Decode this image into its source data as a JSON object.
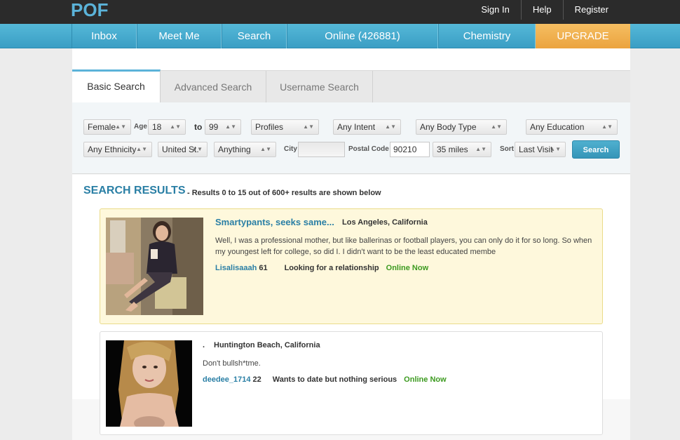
{
  "top": {
    "logo": "POF",
    "links": [
      "Sign In",
      "Help",
      "Register"
    ]
  },
  "nav": {
    "items": [
      "Inbox",
      "Meet Me",
      "Search",
      "Online (426881)",
      "Chemistry",
      "UPGRADE"
    ]
  },
  "tabs": [
    "Basic Search",
    "Advanced Search",
    "Username Search"
  ],
  "filters": {
    "gender": "Female",
    "age_label": "Age",
    "age_min": "18",
    "to_label": "to",
    "age_max": "99",
    "profiles": "Profiles",
    "intent": "Any Intent",
    "body_type": "Any Body Type",
    "education": "Any Education",
    "ethnicity": "Any Ethnicity",
    "country": "United St.",
    "anything": "Anything",
    "city_label": "City",
    "city_value": "",
    "postal_label": "Postal Code",
    "postal_value": "90210",
    "distance": "35 miles",
    "sort_label": "Sort",
    "sort_value": "Last Visit",
    "search_button": "Search"
  },
  "results": {
    "title": "SEARCH RESULTS",
    "subtitle": "- Results 0 to 15 out of 600+ results are shown below",
    "items": [
      {
        "headline": "Smartypants, seeks same...",
        "location": "Los Angeles, California",
        "text": "Well, I was a professional mother, but like ballerinas or football players, you can only do it for so long. So when my youngest left for college, so did I. I didn't want to be the least educated membe",
        "username": "Lisalisaaah",
        "age": "61",
        "intent": "Looking for a relationship",
        "status": "Online Now"
      },
      {
        "headline": ".",
        "location": "Huntington Beach, California",
        "text": "Don't bullsh*tme.",
        "username": "deedee_1714",
        "age": "22",
        "intent": "Wants to date but nothing serious",
        "status": "Online Now"
      }
    ]
  },
  "colors": {
    "accent": "#3a9ec4",
    "upgrade": "#eba33e",
    "online": "#3c9a1f",
    "highlight": "#fef8dc"
  }
}
